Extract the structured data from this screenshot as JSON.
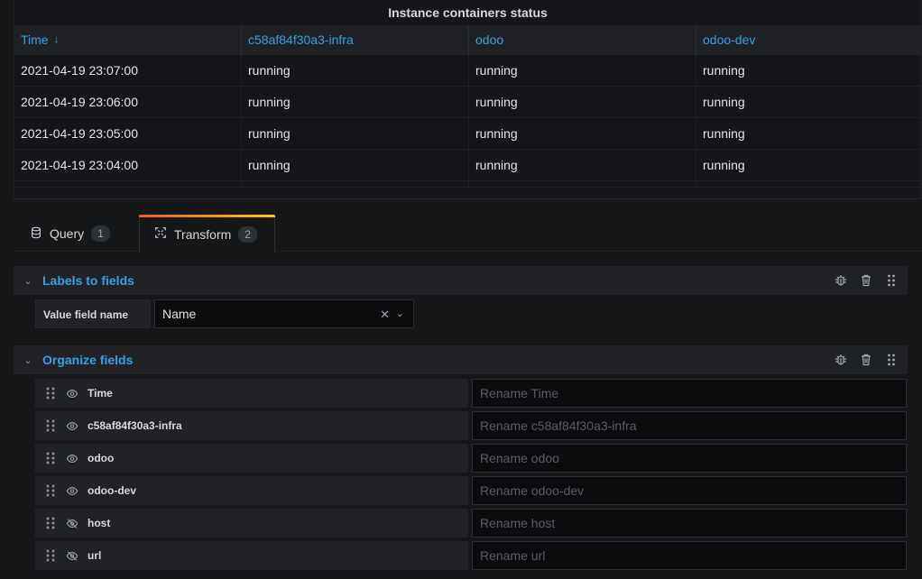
{
  "panel": {
    "title": "Instance containers status",
    "columns": [
      {
        "label": "Time",
        "sorted": "desc"
      },
      {
        "label": "c58af84f30a3-infra"
      },
      {
        "label": "odoo"
      },
      {
        "label": "odoo-dev"
      }
    ],
    "rows": [
      [
        "2021-04-19 23:07:00",
        "running",
        "running",
        "running"
      ],
      [
        "2021-04-19 23:06:00",
        "running",
        "running",
        "running"
      ],
      [
        "2021-04-19 23:05:00",
        "running",
        "running",
        "running"
      ],
      [
        "2021-04-19 23:04:00",
        "running",
        "running",
        "running"
      ]
    ]
  },
  "tabs": [
    {
      "label": "Query",
      "count": "1",
      "icon": "database-icon"
    },
    {
      "label": "Transform",
      "count": "2",
      "icon": "transform-icon",
      "active": true
    }
  ],
  "labels_to_fields": {
    "title": "Labels to fields",
    "value_field_label": "Value field name",
    "value_field_value": "Name"
  },
  "organize_fields": {
    "title": "Organize fields",
    "fields": [
      {
        "name": "Time",
        "visible": true,
        "placeholder": "Rename Time"
      },
      {
        "name": "c58af84f30a3-infra",
        "visible": true,
        "placeholder": "Rename c58af84f30a3-infra"
      },
      {
        "name": "odoo",
        "visible": true,
        "placeholder": "Rename odoo"
      },
      {
        "name": "odoo-dev",
        "visible": true,
        "placeholder": "Rename odoo-dev"
      },
      {
        "name": "host",
        "visible": false,
        "placeholder": "Rename host"
      },
      {
        "name": "url",
        "visible": false,
        "placeholder": "Rename url"
      }
    ]
  },
  "colors": {
    "accent": "#33a2e5",
    "background": "#161719",
    "row": "#202226",
    "input": "#0b0c0e"
  }
}
